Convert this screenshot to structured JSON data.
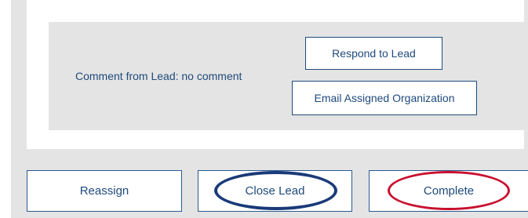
{
  "comment": {
    "text": "Comment from Lead: no comment"
  },
  "actions": {
    "respond_label": "Respond to Lead",
    "email_label": "Email Assigned Organization"
  },
  "footer": {
    "reassign_label": "Reassign",
    "close_label": "Close Lead",
    "complete_label": "Complete"
  },
  "colors": {
    "accent": "#1e4a7c",
    "panel_bg": "#e4e4e4",
    "highlight_blue": "#1a3a78",
    "highlight_red": "#c8102e"
  }
}
